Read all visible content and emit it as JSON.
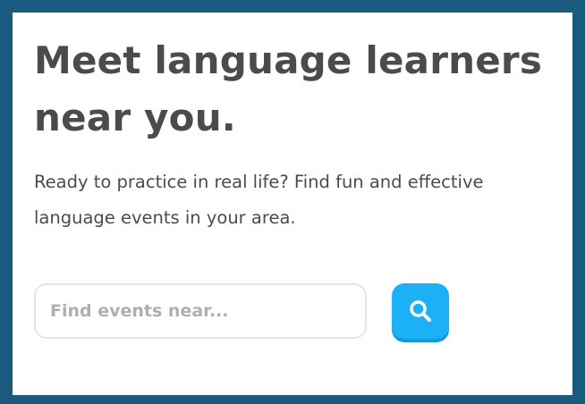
{
  "hero": {
    "headline": "Meet language learners near you.",
    "description": "Ready to practice in real life? Find fun and effective language events in your area."
  },
  "search": {
    "placeholder": "Find events near...",
    "value": "",
    "button_icon": "search-icon"
  },
  "colors": {
    "frame_border": "#1b5a7f",
    "text": "#4b4b4b",
    "placeholder": "#afafaf",
    "input_border": "#e5e5e5",
    "button": "#1cb0f6",
    "button_shadow": "#1899d6"
  }
}
